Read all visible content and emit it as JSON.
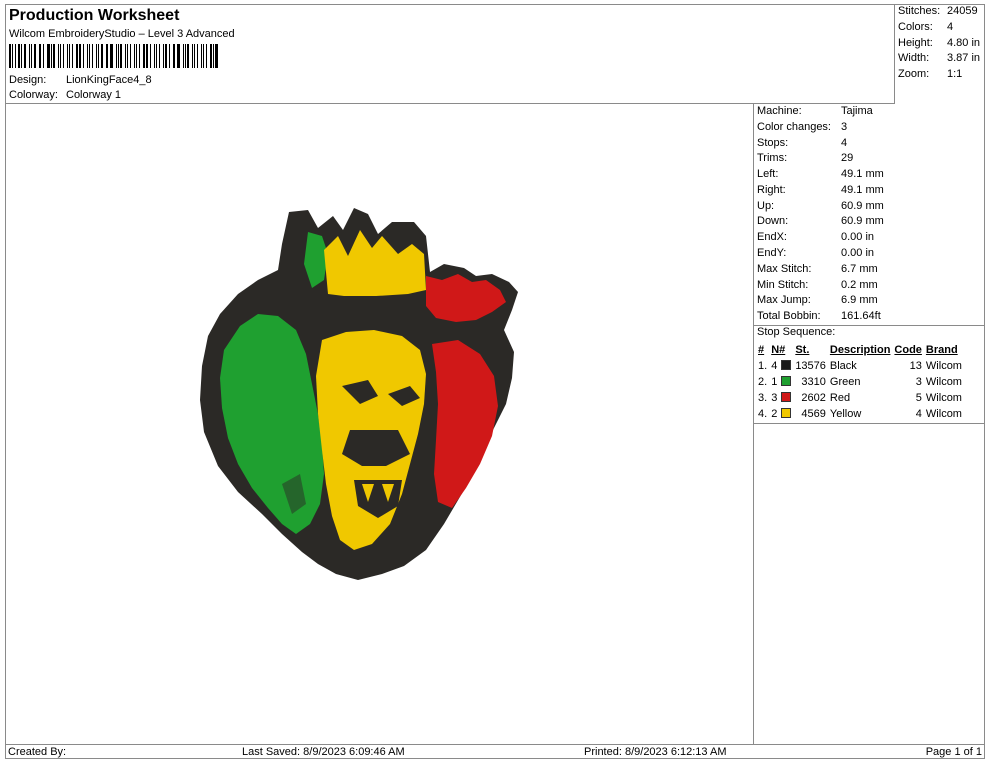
{
  "header": {
    "title": "Production Worksheet",
    "subtitle": "Wilcom EmbroideryStudio – Level 3 Advanced",
    "design_label": "Design:",
    "design_value": "LionKingFace4_8",
    "colorway_label": "Colorway:",
    "colorway_value": "Colorway 1"
  },
  "summary": {
    "stitches_label": "Stitches:",
    "stitches_value": "24059",
    "colors_label": "Colors:",
    "colors_value": "4",
    "height_label": "Height:",
    "height_value": "4.80 in",
    "width_label": "Width:",
    "width_value": "3.87 in",
    "zoom_label": "Zoom:",
    "zoom_value": "1:1"
  },
  "specs": {
    "machine_label": "Machine:",
    "machine_value": "Tajima",
    "color_changes_label": "Color changes:",
    "color_changes_value": "3",
    "stops_label": "Stops:",
    "stops_value": "4",
    "trims_label": "Trims:",
    "trims_value": "29",
    "left_label": "Left:",
    "left_value": "49.1 mm",
    "right_label": "Right:",
    "right_value": "49.1 mm",
    "up_label": "Up:",
    "up_value": "60.9 mm",
    "down_label": "Down:",
    "down_value": "60.9 mm",
    "endx_label": "EndX:",
    "endx_value": "0.00 in",
    "endy_label": "EndY:",
    "endy_value": "0.00 in",
    "max_stitch_label": "Max Stitch:",
    "max_stitch_value": "6.7 mm",
    "min_stitch_label": "Min Stitch:",
    "min_stitch_value": "0.2 mm",
    "max_jump_label": "Max Jump:",
    "max_jump_value": "6.9 mm",
    "total_bobbin_label": "Total Bobbin:",
    "total_bobbin_value": "161.64ft"
  },
  "stop_sequence": {
    "title": "Stop Sequence:",
    "columns": {
      "hash": "#",
      "n": "N#",
      "st": "St.",
      "description": "Description",
      "code": "Code",
      "brand": "Brand"
    },
    "rows": [
      {
        "idx": "1.",
        "n": "4",
        "color": "#1a1a1a",
        "st": "13576",
        "description": "Black",
        "code": "13",
        "brand": "Wilcom"
      },
      {
        "idx": "2.",
        "n": "1",
        "color": "#1fa030",
        "st": "3310",
        "description": "Green",
        "code": "3",
        "brand": "Wilcom"
      },
      {
        "idx": "3.",
        "n": "3",
        "color": "#d01818",
        "st": "2602",
        "description": "Red",
        "code": "5",
        "brand": "Wilcom"
      },
      {
        "idx": "4.",
        "n": "2",
        "color": "#f0c800",
        "st": "4569",
        "description": "Yellow",
        "code": "4",
        "brand": "Wilcom"
      }
    ]
  },
  "footer": {
    "created_by": "Created By:",
    "last_saved": "Last Saved: 8/9/2023 6:09:46 AM",
    "printed": "Printed: 8/9/2023 6:12:13 AM",
    "page": "Page 1 of 1"
  }
}
